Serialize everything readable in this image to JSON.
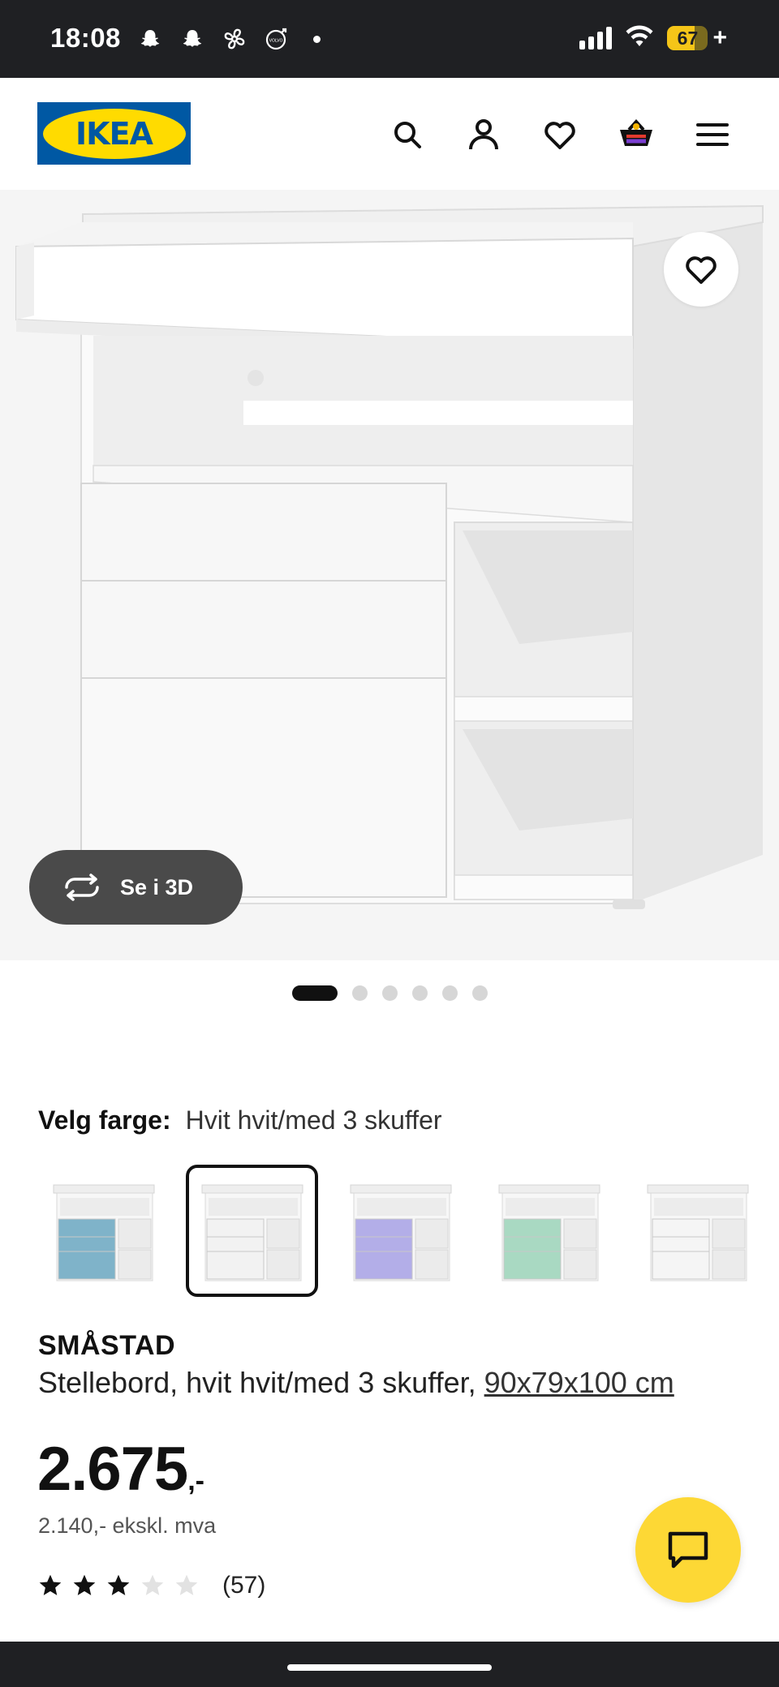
{
  "status_bar": {
    "time": "18:08",
    "battery": "67",
    "battery_level": 0.67,
    "icons": [
      "snapchat-icon",
      "snapchat-icon",
      "fan-icon",
      "volvo-icon",
      "dot-icon",
      "signal-icon",
      "wifi-icon",
      "battery-icon"
    ]
  },
  "header": {
    "logo_text": "IKEA",
    "icons": [
      "search-icon",
      "profile-icon",
      "heart-icon",
      "cart-icon",
      "menu-icon"
    ]
  },
  "gallery": {
    "view3d_label": "Se i 3D",
    "dot_count": 6,
    "active_dot": 0
  },
  "color": {
    "label": "Velg farge:",
    "value": "Hvit hvit/med 3 skuffer",
    "swatches": [
      {
        "drawer_color": "#7fb3c9",
        "selected": false
      },
      {
        "drawer_color": "#f2f2f2",
        "selected": true
      },
      {
        "drawer_color": "#b3aee8",
        "selected": false
      },
      {
        "drawer_color": "#a9d9c2",
        "selected": false
      },
      {
        "drawer_color": "#f5f5f5",
        "selected": false
      }
    ]
  },
  "product": {
    "name": "SMÅSTAD",
    "description": "Stellebord, hvit hvit/med 3 skuffer, ",
    "dimensions": "90x79x100 cm",
    "price": "2.675",
    "price_suffix": ",-",
    "price_ex_vat": "2.140,- ekskl. mva",
    "rating": 3,
    "rating_max": 5,
    "review_count": "(57)"
  },
  "colors": {
    "status_bar": "#1f2023",
    "ikea_blue": "#0058a3",
    "ikea_yellow": "#ffdb00",
    "chat_fab": "#fdd835"
  }
}
